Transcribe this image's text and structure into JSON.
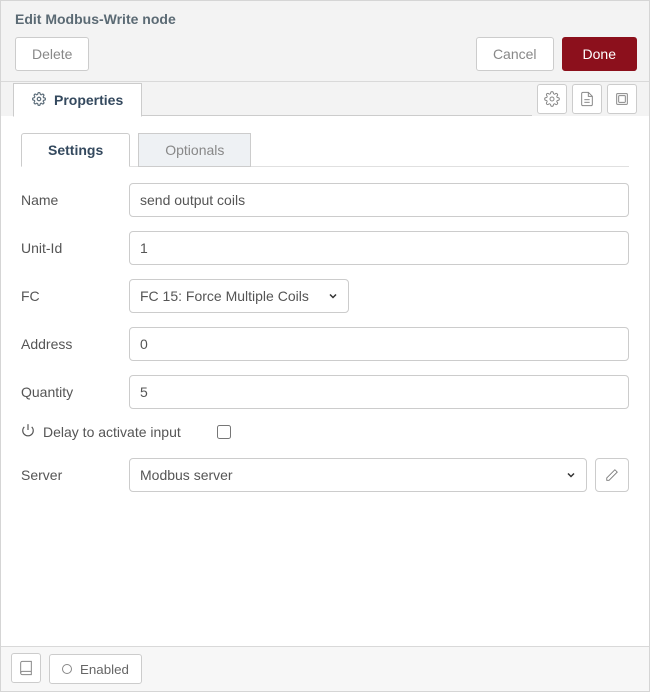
{
  "header": {
    "title": "Edit Modbus-Write node",
    "delete": "Delete",
    "cancel": "Cancel",
    "done": "Done"
  },
  "editorTabs": {
    "properties": "Properties"
  },
  "innerTabs": {
    "settings": "Settings",
    "optionals": "Optionals"
  },
  "form": {
    "nameLabel": "Name",
    "nameValue": "send output coils",
    "unitIdLabel": "Unit-Id",
    "unitIdValue": "1",
    "fcLabel": "FC",
    "fcValue": "FC 15: Force Multiple Coils",
    "addressLabel": "Address",
    "addressValue": "0",
    "quantityLabel": "Quantity",
    "quantityValue": "5",
    "delayLabel": "Delay to activate input",
    "serverLabel": "Server",
    "serverValue": "Modbus server"
  },
  "footer": {
    "enabled": "Enabled"
  }
}
